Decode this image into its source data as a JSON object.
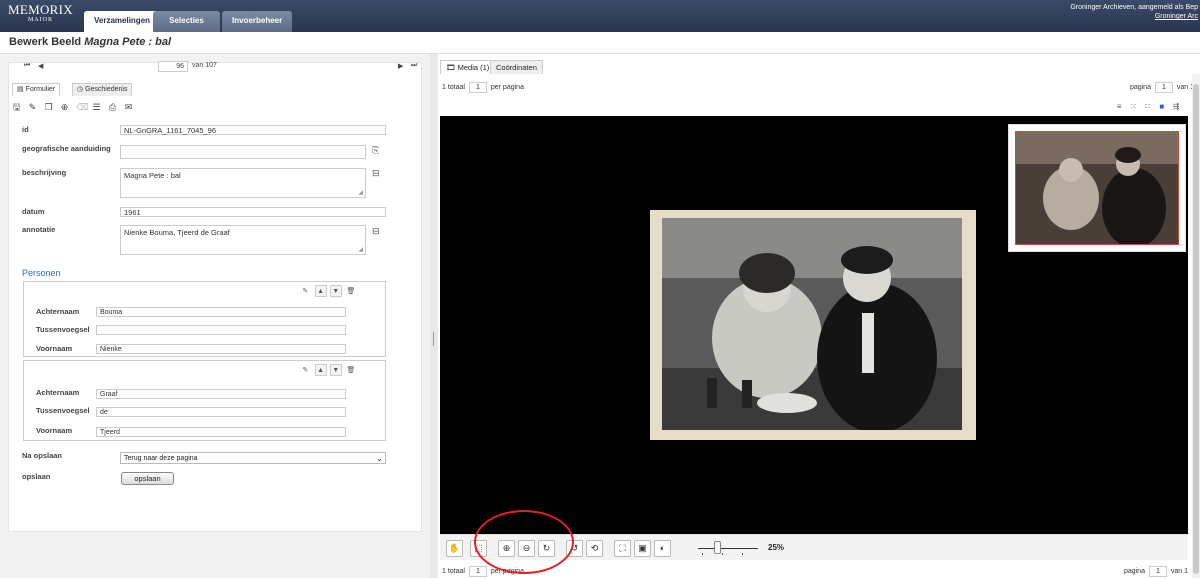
{
  "app": {
    "logo_line1": "MEMORIX",
    "logo_line2": "MAIOR",
    "tabs": [
      "Verzamelingen",
      "Selecties",
      "Invoerbeheer"
    ],
    "login_line1": "Groninger Archieven, aangemeld als Bep",
    "login_line2": "Groninger Arc"
  },
  "page": {
    "title_prefix": "Bewerk Beeld",
    "title_item": "Magna Pete : bal"
  },
  "record_nav": {
    "current": "96",
    "of_label": "van 107",
    "first": "⏮",
    "prev": "◀",
    "next": "▶",
    "last": "⏭"
  },
  "form_tabs": [
    "Formulier",
    "Geschiedenis"
  ],
  "fields": {
    "id_label": "id",
    "id_value": "NL-GnGRA_1161_7045_96",
    "geo_label": "geografische aanduiding",
    "geo_value": "",
    "desc_label": "beschrijving",
    "desc_value": "Magna Pete : bal",
    "date_label": "datum",
    "date_value": "1961",
    "annot_label": "annotatie",
    "annot_value": "Nienke Bouma, Tjeerd de Graaf"
  },
  "persons": {
    "title": "Personen",
    "labels": {
      "last": "Achternaam",
      "middle": "Tussenvoegsel",
      "first": "Voornaam"
    },
    "list": [
      {
        "last": "Bouma",
        "middle": "",
        "first": "Nienke"
      },
      {
        "last": "Graaf",
        "middle": "de",
        "first": "Tjeerd"
      }
    ]
  },
  "after_save": {
    "label": "Na opslaan",
    "value": "Terug naar deze pagina"
  },
  "save": {
    "label": "opslaan",
    "button": "opslaan"
  },
  "media": {
    "tabs": [
      "Media (1)",
      "Coördinaten"
    ],
    "total_label": "1 totaal",
    "per_page_value": "1",
    "per_page_label": "per pagina",
    "page_label": "pagina",
    "page_value": "1",
    "of_label": "van 1",
    "zoom": "25%"
  },
  "colors": {
    "topbar": "#2f3b55",
    "accent_link": "#3a6ea5",
    "annotation_ring": "#e32020"
  }
}
